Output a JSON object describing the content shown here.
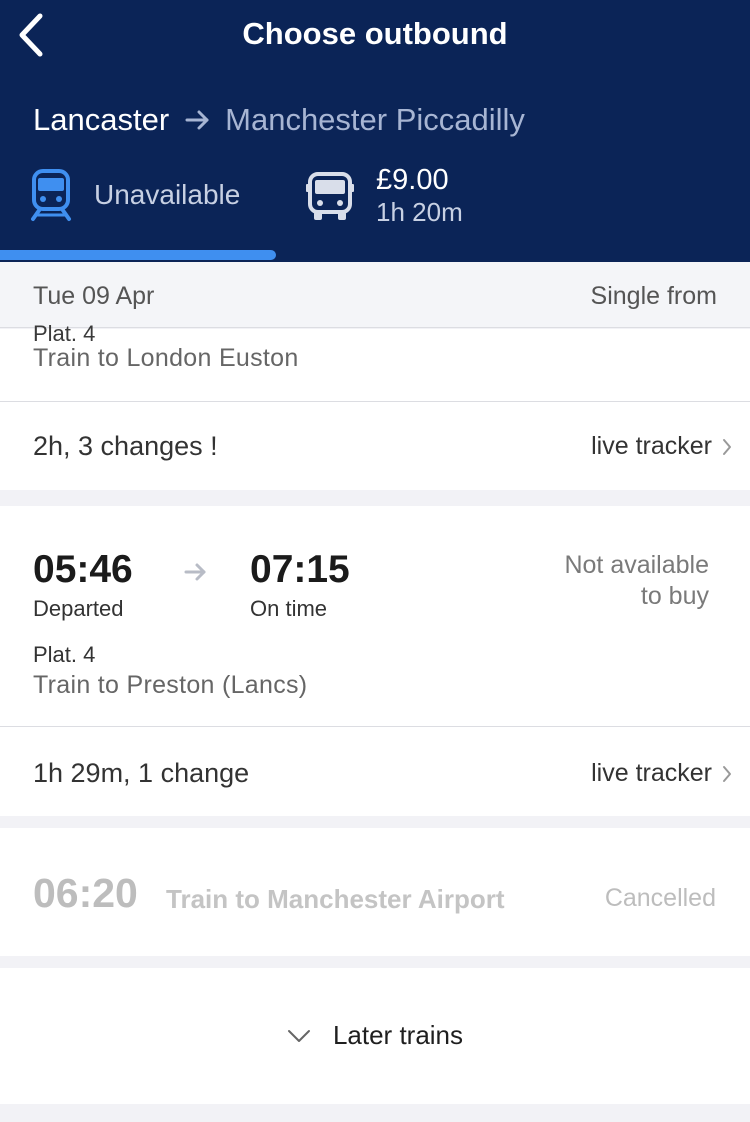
{
  "header": {
    "title": "Choose outbound",
    "origin": "Lancaster",
    "destination": "Manchester Piccadilly",
    "train_tab": {
      "label": "Unavailable",
      "icon": "train-icon"
    },
    "bus_tab": {
      "price": "£9.00",
      "duration": "1h 20m",
      "icon": "bus-icon"
    },
    "colors": {
      "background": "#0b2457",
      "active_tab": "#3f8ff0"
    }
  },
  "date_bar": {
    "date": "Tue 09 Apr",
    "fare_label": "Single from"
  },
  "journeys": [
    {
      "platform": "Plat. 4",
      "train": "Train to London Euston",
      "summary": "2h, 3 changes !",
      "tracker": "live tracker"
    },
    {
      "depart": "05:46",
      "depart_status": "Departed",
      "arrive": "07:15",
      "arrive_status": "On time",
      "availability_line1": "Not available",
      "availability_line2": "to buy",
      "platform": "Plat. 4",
      "train": "Train to Preston (Lancs)",
      "summary": "1h 29m, 1 change",
      "tracker": "live tracker"
    },
    {
      "depart": "06:20",
      "train": "Train to Manchester Airport",
      "status": "Cancelled"
    }
  ],
  "later_trains": {
    "label": "Later trains",
    "icon": "chevron-down-icon"
  }
}
